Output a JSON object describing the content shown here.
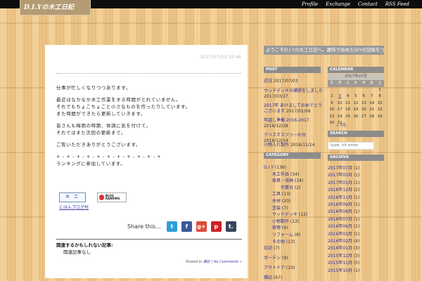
{
  "header": {
    "logo_text": "D.I.Yの木工日記",
    "nav": [
      "Profile",
      "Exchange",
      "Contact",
      "RSS Feed"
    ]
  },
  "post": {
    "date": "2017/07/03 10:46",
    "body_lines": [
      "仕事が忙しくなりつつあります。",
      "",
      "最近はなかなか木工作業をする時間がとれていません。",
      "それでもちょこちょこと小さなものを作ったりしています。",
      "また時間ができたら更新していきます。",
      "",
      "皆さんも梅雨の時期、体調に気を付けて。",
      "それではまた次回の更新まで。",
      "",
      "ご覧いただきありがとうございます。",
      "",
      "+ - + - + - + - + - + - + - + - + - + - +",
      "ランキングに参加しています。"
    ],
    "banner_mokko": "木 工",
    "banner_blog": "BLOG RANKING",
    "banner_link": "にほんブログ村",
    "share_label": "Share this...",
    "share_icons": [
      "twitter-icon",
      "facebook-icon",
      "google-plus-icon",
      "pinterest-icon",
      "tumblr-icon"
    ],
    "related_title": "関連するかもしれない記事:",
    "related_item": "関連記事なし",
    "meta_posted": "Posted in",
    "meta_category": "雑記",
    "meta_comments": "No Comments »"
  },
  "sidebar": {
    "blog_title": "ようこそD.I.Yの木工日記へ。趣味で始めたDIYの記録をつづっています。",
    "post_head": "POST",
    "posts": [
      {
        "title": "近況",
        "date": "2017/07/03"
      },
      {
        "title": "ウッドデッキの補修をしました",
        "date": "2017/03/27"
      },
      {
        "title": "2017年 あけましておめでとうございます",
        "date": "2017/01/06"
      },
      {
        "title": "年越し準備 2016-2017",
        "date": "2016/12/28"
      },
      {
        "title": "クリスマスツリーの台",
        "date": "2016/12/14"
      },
      {
        "title": "小物入れ製作",
        "date": "2016/11/14"
      }
    ],
    "category_head": "CATEGORY",
    "categories": [
      {
        "name": "D.I.Y",
        "count": "(136)",
        "indent": 0
      },
      {
        "name": "木工作品",
        "count": "(34)",
        "indent": 1
      },
      {
        "name": "家具・収納",
        "count": "(34)",
        "indent": 1
      },
      {
        "name": "作業台",
        "count": "(2)",
        "indent": 2
      },
      {
        "name": "工具",
        "count": "(13)",
        "indent": 1
      },
      {
        "name": "木材",
        "count": "(20)",
        "indent": 1
      },
      {
        "name": "塗装",
        "count": "(7)",
        "indent": 1
      },
      {
        "name": "ウッドデッキ",
        "count": "(12)",
        "indent": 1
      },
      {
        "name": "小物製作",
        "count": "(13)",
        "indent": 1
      },
      {
        "name": "修理",
        "count": "(6)",
        "indent": 1
      },
      {
        "name": "リフォーム",
        "count": "(8)",
        "indent": 1
      },
      {
        "name": "その他",
        "count": "(13)",
        "indent": 1
      },
      {
        "name": "日記",
        "count": "(7)",
        "indent": 0
      },
      {
        "name": "ガーデン",
        "count": "(9)",
        "indent": 0
      },
      {
        "name": "アウトドア",
        "count": "(10)",
        "indent": 0
      },
      {
        "name": "雑記",
        "count": "(67)",
        "indent": 0
      }
    ],
    "calendar_head": "CALENDAR",
    "calendar_month": "2017年07月",
    "calendar_days": [
      "日",
      "月",
      "火",
      "水",
      "木",
      "金",
      "土"
    ],
    "calendar_weeks": [
      [
        "",
        "",
        "",
        "",
        "",
        "",
        "1"
      ],
      [
        "2",
        "3",
        "4",
        "5",
        "6",
        "7",
        "8"
      ],
      [
        "9",
        "10",
        "11",
        "12",
        "13",
        "14",
        "15"
      ],
      [
        "16",
        "17",
        "18",
        "19",
        "20",
        "21",
        "22"
      ],
      [
        "23",
        "24",
        "25",
        "26",
        "27",
        "28",
        "29"
      ],
      [
        "30",
        "31",
        "",
        "",
        "",
        "",
        ""
      ]
    ],
    "calendar_prev": "« 7月",
    "search_head": "SEARCH",
    "search_placeholder": "type, hit enter",
    "archive_head": "ARCHIVE",
    "archives": [
      {
        "month": "2017年07月",
        "count": "(1)"
      },
      {
        "month": "2017年03月",
        "count": "(1)"
      },
      {
        "month": "2017年01月",
        "count": "(1)"
      },
      {
        "month": "2016年12月",
        "count": "(2)"
      },
      {
        "month": "2016年11月",
        "count": "(1)"
      },
      {
        "month": "2016年09月",
        "count": "(1)"
      },
      {
        "month": "2016年08月",
        "count": "(1)"
      },
      {
        "month": "2016年07月",
        "count": "(1)"
      },
      {
        "month": "2016年06月",
        "count": "(1)"
      },
      {
        "month": "2016年03月",
        "count": "(1)"
      },
      {
        "month": "2016年02月",
        "count": "(4)"
      },
      {
        "month": "2016年01月",
        "count": "(3)"
      },
      {
        "month": "2015年12月",
        "count": "(3)"
      },
      {
        "month": "2015年11月",
        "count": "(5)"
      },
      {
        "month": "2015年10月",
        "count": "(1)"
      }
    ]
  }
}
